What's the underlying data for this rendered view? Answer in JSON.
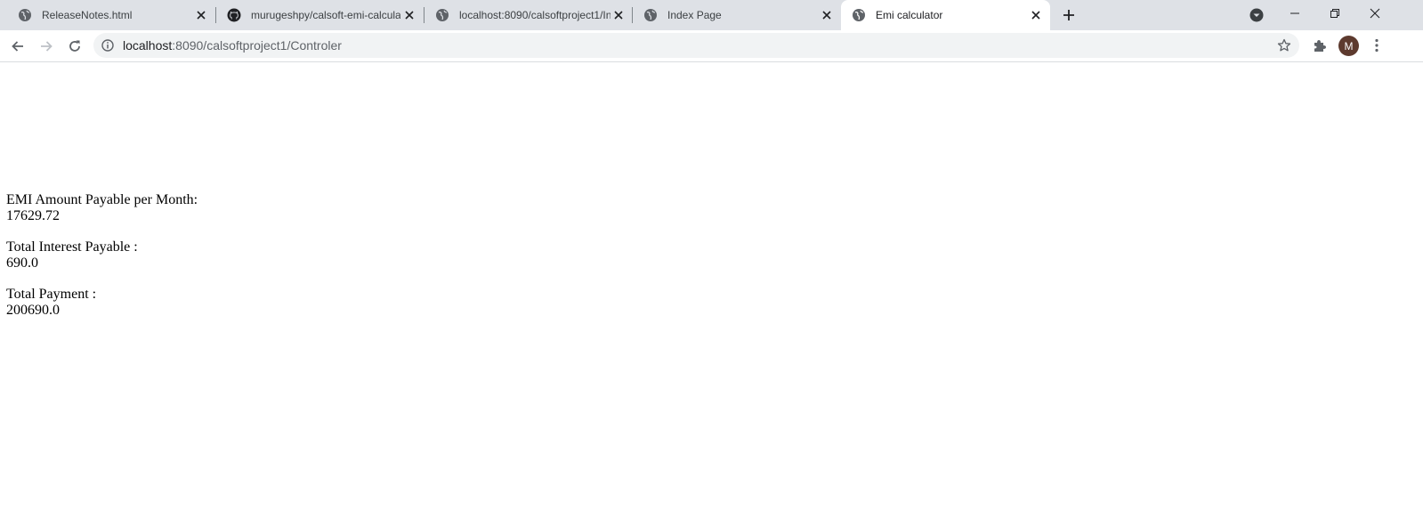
{
  "browser": {
    "tabs": [
      {
        "title": "ReleaseNotes.html",
        "icon": "globe-icon",
        "active": false
      },
      {
        "title": "murugeshpy/calsoft-emi-calculat",
        "icon": "github-icon",
        "active": false
      },
      {
        "title": "localhost:8090/calsoftproject1/In",
        "icon": "globe-icon",
        "active": false
      },
      {
        "title": "Index Page",
        "icon": "globe-icon",
        "active": false
      },
      {
        "title": "Emi calculator",
        "icon": "globe-icon",
        "active": true
      }
    ],
    "address": {
      "host": "localhost",
      "path": ":8090/calsoftproject1/Controler"
    },
    "profile_initial": "M",
    "colors": {
      "tabstrip": "#dee1e6",
      "omnibox": "#f1f3f4",
      "avatar": "#5d3a2e"
    }
  },
  "results": {
    "emi_label": "EMI Amount Payable per Month:",
    "emi_value": "17629.72",
    "interest_label": "Total Interest Payable :",
    "interest_value": "690.0",
    "payment_label": "Total Payment :",
    "payment_value": "200690.0"
  }
}
